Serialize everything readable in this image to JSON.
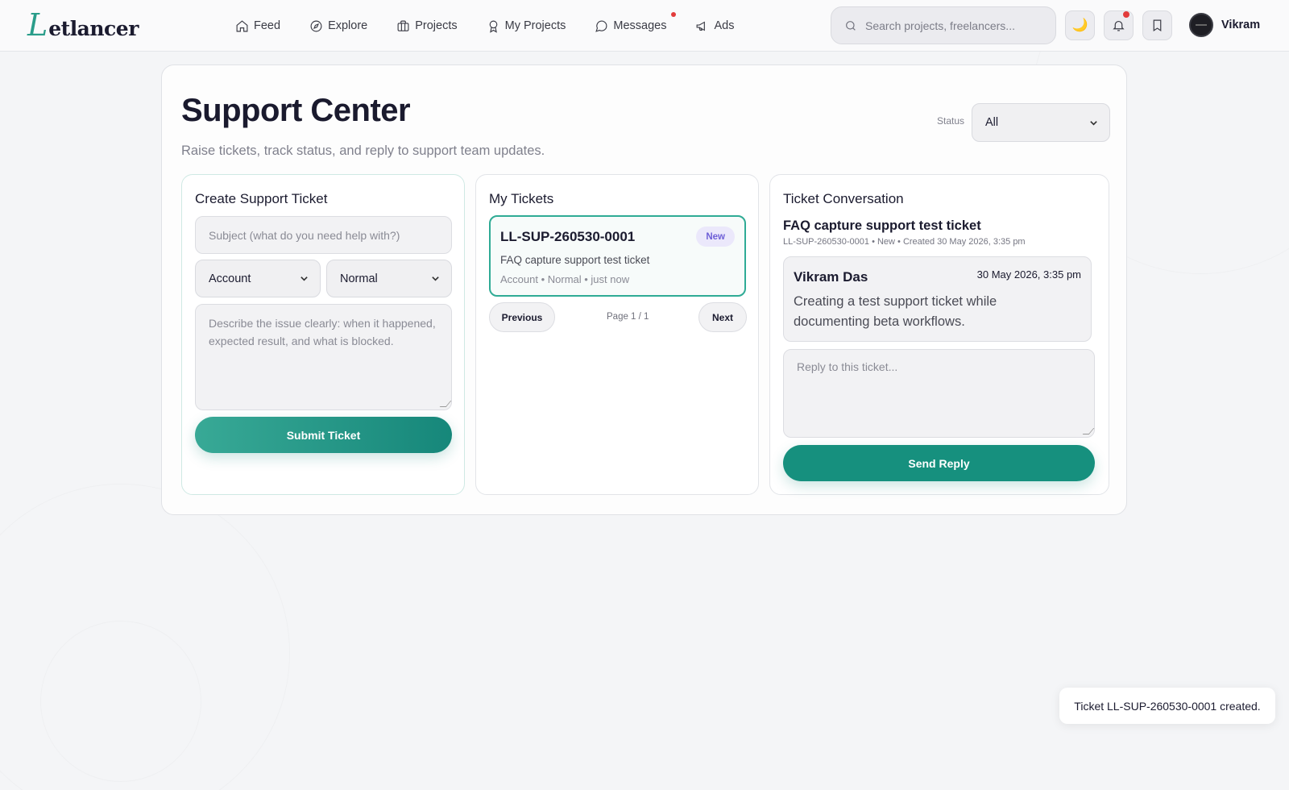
{
  "brand": {
    "logo_initial": "L",
    "logo_rest": "etlancer"
  },
  "nav": {
    "items": [
      {
        "label": "Feed",
        "icon": "home-icon"
      },
      {
        "label": "Explore",
        "icon": "compass-icon"
      },
      {
        "label": "Projects",
        "icon": "briefcase-icon"
      },
      {
        "label": "My Projects",
        "icon": "award-icon"
      },
      {
        "label": "Messages",
        "icon": "message-circle-icon"
      },
      {
        "label": "Ads",
        "icon": "megaphone-icon"
      }
    ]
  },
  "search": {
    "placeholder": "Search projects, freelancers..."
  },
  "header_actions": {
    "theme_glyph": "🌙",
    "user_name": "Vikram"
  },
  "page": {
    "title": "Support Center",
    "subtitle": "Raise tickets, track status, and reply to support team updates.",
    "status_label": "Status",
    "status_value": "All"
  },
  "create_ticket": {
    "title": "Create Support Ticket",
    "subject_placeholder": "Subject (what do you need help with?)",
    "category_value": "Account",
    "priority_value": "Normal",
    "description_placeholder": "Describe the issue clearly: when it happened, expected result, and what is blocked.",
    "submit_label": "Submit Ticket"
  },
  "my_tickets": {
    "title": "My Tickets",
    "tickets": [
      {
        "id": "LL-SUP-260530-0001",
        "status": "New",
        "subject": "FAQ capture support test ticket",
        "meta": "Account • Normal • just now"
      }
    ],
    "prev_label": "Previous",
    "page_info": "Page 1 / 1",
    "next_label": "Next"
  },
  "conversation": {
    "title": "Ticket Conversation",
    "subject": "FAQ capture support test ticket",
    "meta": "LL-SUP-260530-0001 • New • Created 30 May 2026, 3:35 pm",
    "messages": [
      {
        "author": "Vikram Das",
        "time": "30 May 2026, 3:35 pm",
        "body": "Creating a test support ticket while documenting beta workflows."
      }
    ],
    "reply_placeholder": "Reply to this ticket...",
    "send_label": "Send Reply"
  },
  "toast": {
    "text": "Ticket LL-SUP-260530-0001 created."
  },
  "colors": {
    "accent": "#16907e",
    "accent_light": "#38a996",
    "badge_bg": "#ebe8fb",
    "badge_text": "#6e5fd7",
    "notification_dot": "#e23b3b"
  }
}
